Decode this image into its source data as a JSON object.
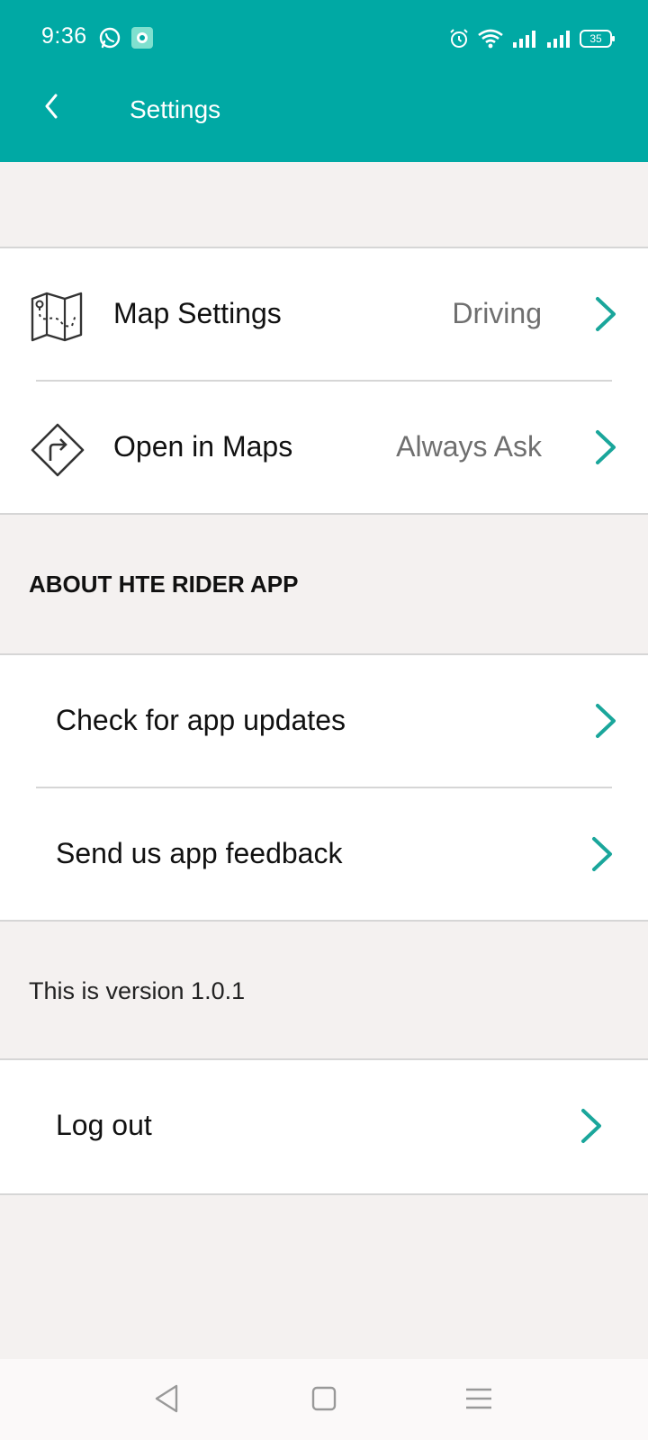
{
  "status_bar": {
    "time": "9:36",
    "battery_level": "35"
  },
  "header": {
    "title": "Settings"
  },
  "settings": {
    "map_settings": {
      "label": "Map Settings",
      "value": "Driving"
    },
    "open_in_maps": {
      "label": "Open in Maps",
      "value": "Always Ask"
    }
  },
  "about": {
    "header": "ABOUT HTE RIDER APP",
    "check_updates": "Check for app updates",
    "send_feedback": "Send us app feedback"
  },
  "version_text": "This is version 1.0.1",
  "logout": {
    "label": "Log out"
  },
  "colors": {
    "accent": "#00a9a4",
    "chevron": "#1aa69b",
    "background": "#f4f1f0"
  }
}
